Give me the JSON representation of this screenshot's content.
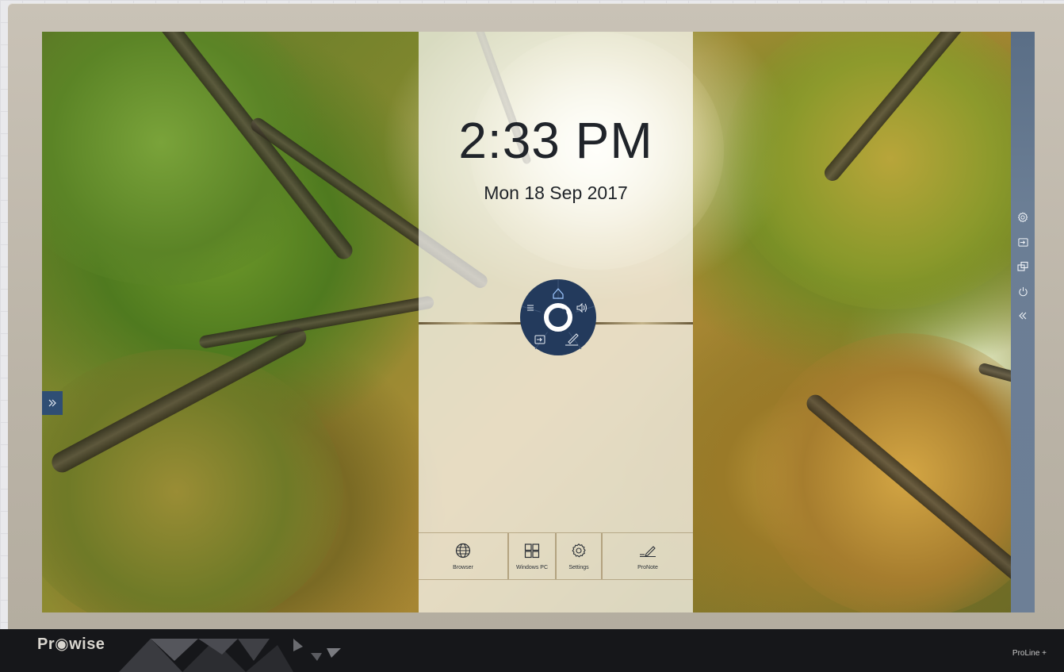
{
  "clock": {
    "time": "2:33 PM",
    "date": "Mon 18 Sep 2017"
  },
  "apps": [
    {
      "label": "Browser",
      "icon": "globe-icon"
    },
    {
      "label": "Windows PC",
      "icon": "windows-icon"
    },
    {
      "label": "Settings",
      "icon": "gear-icon"
    },
    {
      "label": "ProNote",
      "icon": "pen-icon"
    }
  ],
  "radial_menu": {
    "items": [
      "home-icon",
      "volume-icon",
      "pen-icon",
      "input-source-icon",
      "menu-icon"
    ],
    "center": "prowise-logo-icon"
  },
  "right_sidebar": {
    "items": [
      "gear-icon",
      "input-source-icon",
      "screen-share-icon",
      "power-icon",
      "collapse-icon"
    ]
  },
  "left_toggle": {
    "icon": "expand-icon"
  },
  "bezel": {
    "brand": "Pr◉wise",
    "model": "ProLine +"
  },
  "colors": {
    "navy": "#233a5c",
    "sidebar": "#6b7e95",
    "bezel": "#16171a"
  }
}
